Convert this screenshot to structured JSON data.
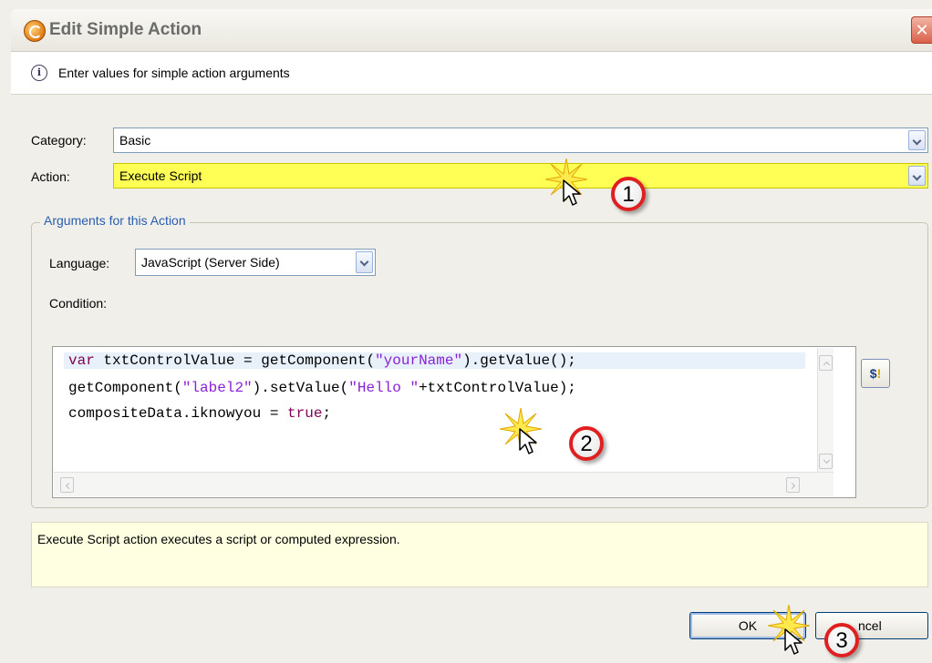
{
  "dialog": {
    "title": "Edit Simple Action",
    "close_glyph": "✕",
    "info_text": "Enter values for simple action arguments"
  },
  "form": {
    "category_label": "Category:",
    "category_value": "Basic",
    "action_label": "Action:",
    "action_value": "Execute Script"
  },
  "arguments": {
    "legend": "Arguments for this Action",
    "language_label": "Language:",
    "language_value": "JavaScript (Server Side)",
    "condition_label": "Condition:"
  },
  "code_segments": {
    "l1_kw": "var",
    "l1_a": " txtControlValue = getComponent(",
    "l1_str": "\"yourName\"",
    "l1_b": ").getValue();",
    "l2_a": "getComponent(",
    "l2_str1": "\"label2\"",
    "l2_b": ").setValue(",
    "l2_str2": "\"Hello \"",
    "l2_c": "+txtControlValue);",
    "l3_a": "compositeData.iknowyou = ",
    "l3_kw": "true",
    "l3_b": ";"
  },
  "script_button": {
    "label_main": "$",
    "label_accent": "!"
  },
  "description": "Execute Script action executes a script or computed expression.",
  "buttons": {
    "ok": "OK",
    "cancel": "ncel"
  },
  "annotations": {
    "step1": "1",
    "step2": "2",
    "step3": "3"
  },
  "colors": {
    "action_highlight": "#ffff55",
    "callout_ring": "#e02020",
    "keyword": "#7f0055",
    "string": "#8a20d8",
    "legend_text": "#2a5db0"
  }
}
